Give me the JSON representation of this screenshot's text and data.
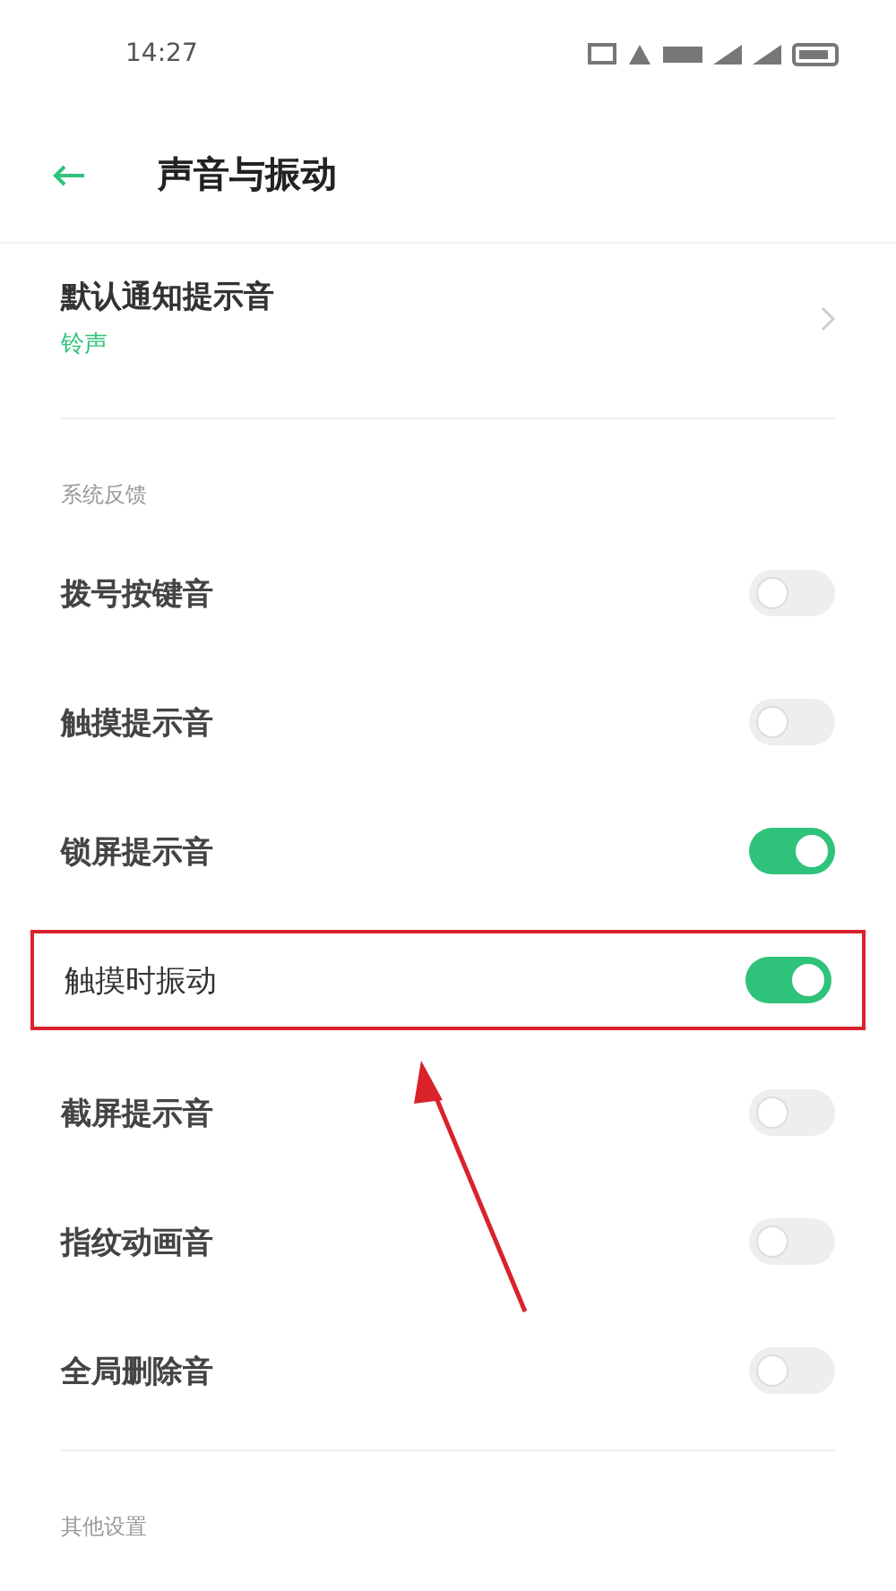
{
  "status_bar": {
    "time": "14:27"
  },
  "header": {
    "title": "声音与振动"
  },
  "notification_sound": {
    "label": "默认通知提示音",
    "value": "铃声"
  },
  "sections": [
    {
      "title": "系统反馈",
      "items": [
        {
          "label": "拨号按键音",
          "on": false,
          "highlighted": false
        },
        {
          "label": "触摸提示音",
          "on": false,
          "highlighted": false
        },
        {
          "label": "锁屏提示音",
          "on": true,
          "highlighted": false
        },
        {
          "label": "触摸时振动",
          "on": true,
          "highlighted": true
        },
        {
          "label": "截屏提示音",
          "on": false,
          "highlighted": false
        },
        {
          "label": "指纹动画音",
          "on": false,
          "highlighted": false
        },
        {
          "label": "全局删除音",
          "on": false,
          "highlighted": false
        }
      ]
    },
    {
      "title": "其他设置"
    }
  ]
}
